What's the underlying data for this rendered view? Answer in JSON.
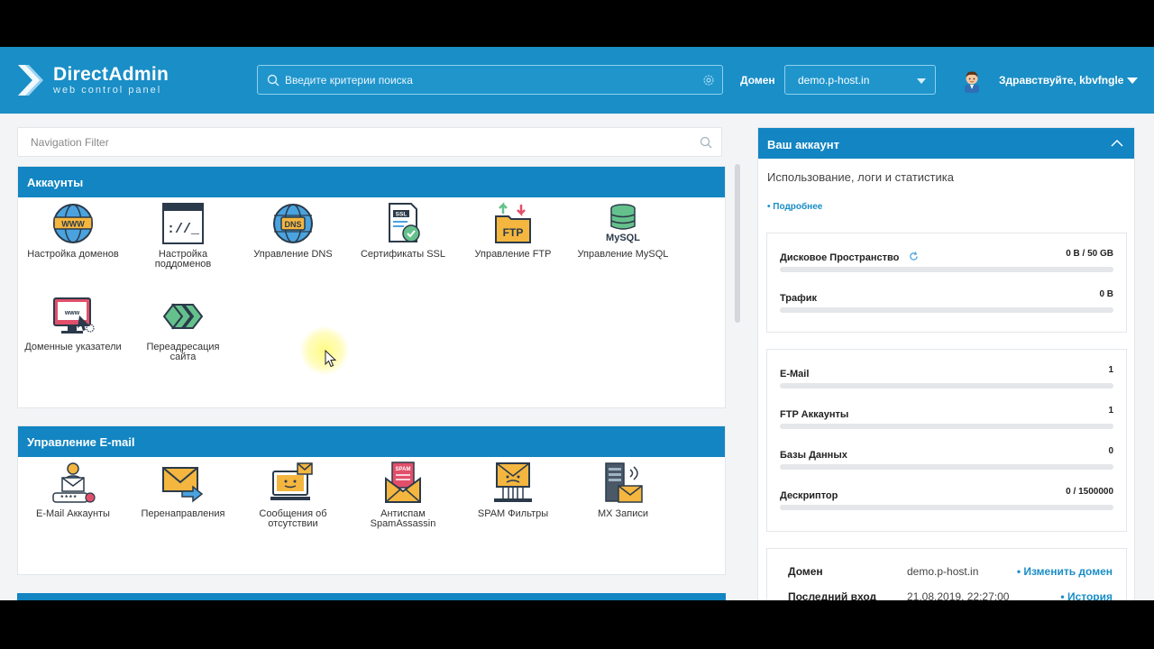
{
  "header": {
    "logo_title": "DirectAdmin",
    "logo_subtitle": "web control panel",
    "search_placeholder": "Введите критерии поиска",
    "domain_label": "Домен",
    "domain_value": "demo.p-host.in",
    "greeting": "Здравствуйте, kbvfngle"
  },
  "nav_filter": {
    "placeholder": "Navigation Filter"
  },
  "sections": {
    "accounts": {
      "title": "Аккаунты",
      "tiles": [
        {
          "label": "Настройка доменов",
          "icon": "globe-www-icon"
        },
        {
          "label": "Настройка поддоменов",
          "icon": "terminal-window-icon"
        },
        {
          "label": "Управление DNS",
          "icon": "dns-globe-icon"
        },
        {
          "label": "Сертификаты SSL",
          "icon": "ssl-certificate-icon"
        },
        {
          "label": "Управление FTP",
          "icon": "ftp-folder-icon"
        },
        {
          "label": "Управление MySQL",
          "icon": "mysql-database-icon"
        },
        {
          "label": "Доменные указатели",
          "icon": "domain-pointer-icon"
        },
        {
          "label": "Переадресация сайта",
          "icon": "redirect-arrows-icon"
        }
      ]
    },
    "email": {
      "title": "Управление E-mail",
      "tiles": [
        {
          "label": "E-Mail Аккаунты",
          "icon": "email-account-icon"
        },
        {
          "label": "Перенаправления",
          "icon": "email-forward-icon"
        },
        {
          "label": "Сообщения об отсутствии",
          "icon": "autoresponder-icon"
        },
        {
          "label": "Антиспам SpamAssassin",
          "icon": "spam-envelope-icon"
        },
        {
          "label": "SPAM Фильтры",
          "icon": "spam-filter-icon"
        },
        {
          "label": "MX Записи",
          "icon": "mx-server-icon"
        }
      ]
    }
  },
  "account": {
    "title": "Ваш аккаунт",
    "subtitle": "Использование, логи и статистика",
    "more_link": "• Подробнее",
    "usage": [
      {
        "name": "Дисковое Пространство",
        "value": "0 B / 50 GB"
      },
      {
        "name": "Трафик",
        "value": "0 B"
      }
    ],
    "counts": [
      {
        "name": "E-Mail",
        "value": "1"
      },
      {
        "name": "FTP Аккаунты",
        "value": "1"
      },
      {
        "name": "Базы Данных",
        "value": "0"
      },
      {
        "name": "Дескриптор",
        "value": "0 / 1500000"
      }
    ],
    "info": [
      {
        "key": "Домен",
        "value": "demo.p-host.in",
        "action": "• Изменить домен"
      },
      {
        "key": "Последний вход",
        "value": "21.08.2019, 22:27:00",
        "action": "• История"
      }
    ]
  },
  "colors": {
    "header_bg": "#1a8ec6",
    "panel_header": "#1285c2",
    "link": "#1a8ec6"
  }
}
